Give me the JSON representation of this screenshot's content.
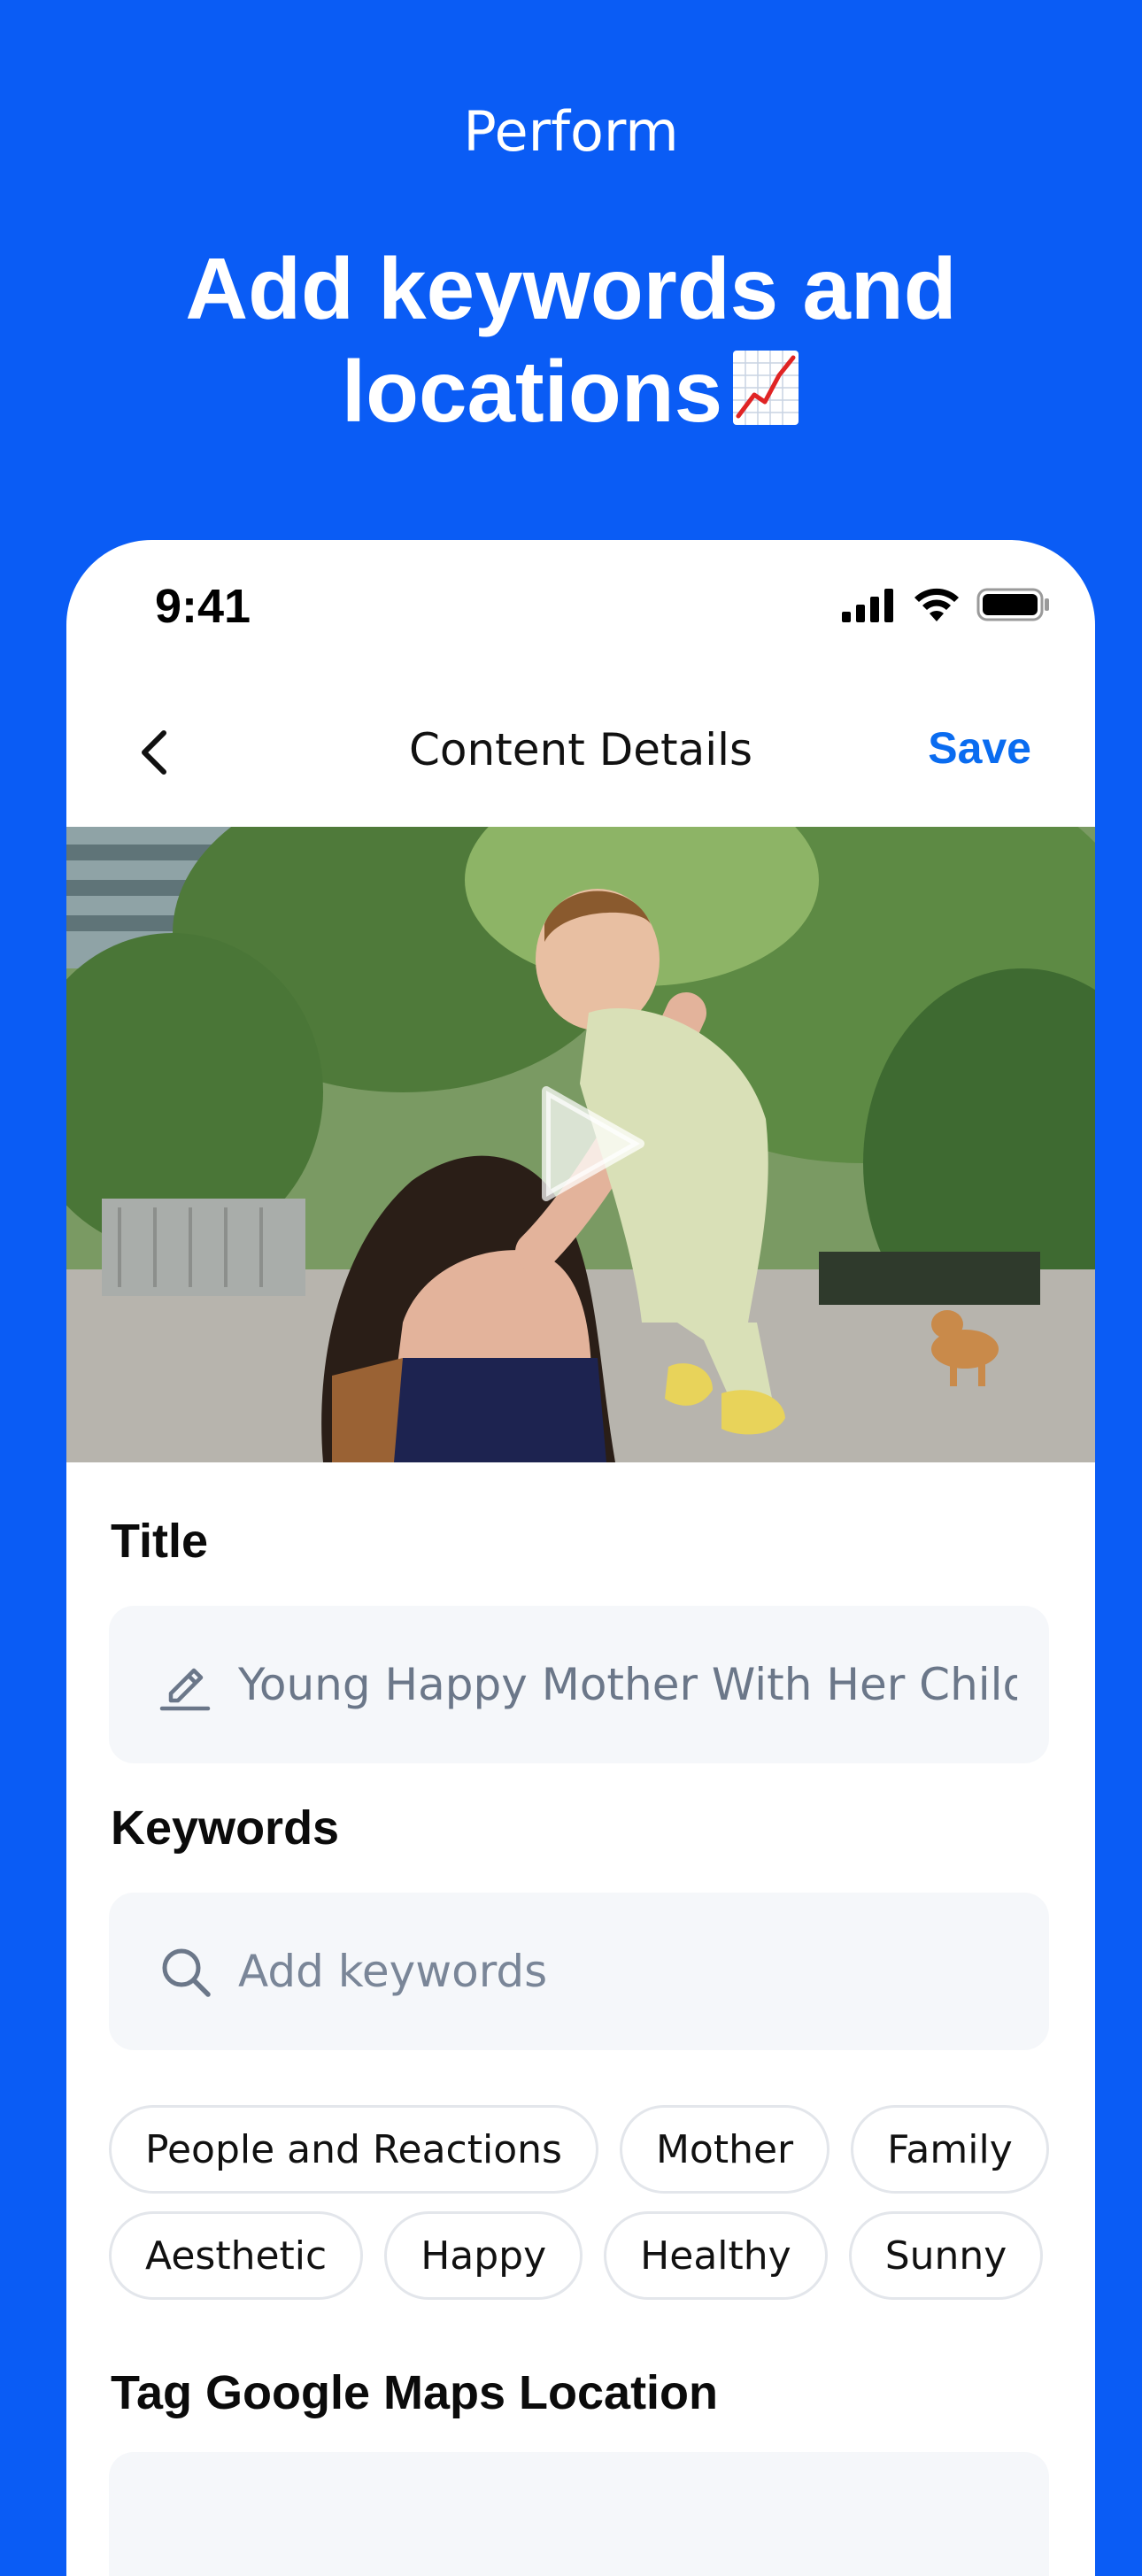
{
  "banner": {
    "eyebrow": "Perform",
    "headline": "Add keywords and\nlocations",
    "headline_emoji": "chart-increasing-icon"
  },
  "status_bar": {
    "time": "9:41",
    "icons": [
      "cellular-signal-icon",
      "wifi-icon",
      "battery-icon"
    ]
  },
  "nav": {
    "back_icon": "chevron-left-icon",
    "title": "Content Details",
    "save_label": "Save"
  },
  "media": {
    "play_icon": "play-icon"
  },
  "title_section": {
    "label": "Title",
    "icon": "pencil-icon",
    "value": "Young Happy Mother With Her Child"
  },
  "keywords_section": {
    "label": "Keywords",
    "icon": "search-icon",
    "placeholder": "Add keywords",
    "chips": [
      [
        "People and Reactions",
        "Mother",
        "Family"
      ],
      [
        "Aesthetic",
        "Happy",
        "Healthy",
        "Sunny"
      ]
    ]
  },
  "location_section": {
    "label": "Tag Google Maps Location"
  },
  "colors": {
    "background": "#0A5CF5",
    "accent": "#0A6CF0",
    "field_bg": "#F5F7FA",
    "chip_border": "#E3E6EB"
  }
}
